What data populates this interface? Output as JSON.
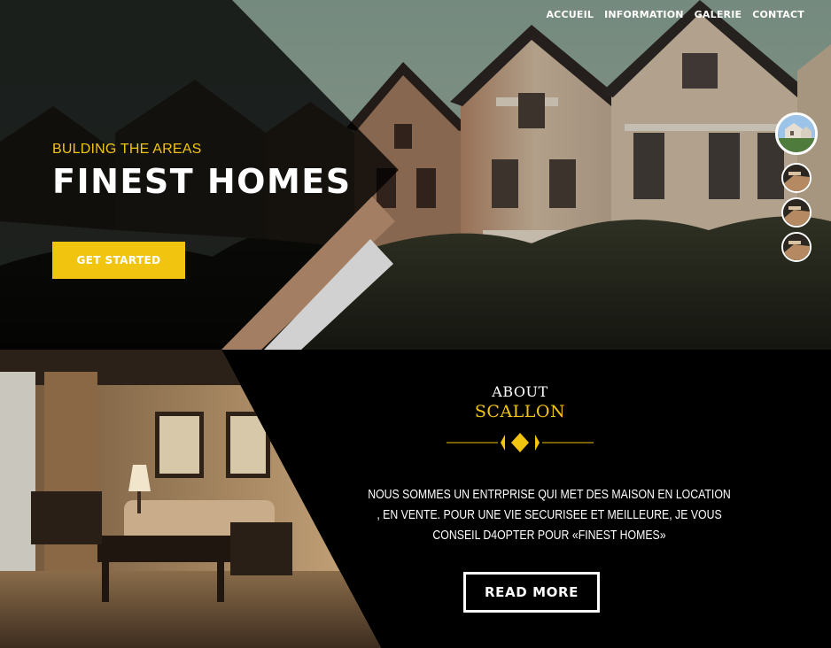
{
  "nav": {
    "items": [
      "ACCUEIL",
      "INFORMATION",
      "GALERIE",
      "CONTACT"
    ]
  },
  "hero": {
    "subtitle": "BULDING THE AREAS",
    "title": "FINEST HOMES",
    "cta_label": "GET STARTED"
  },
  "slider": {
    "thumbnails": [
      "house-thumbnail",
      "slide-thumbnail",
      "slide-thumbnail",
      "slide-thumbnail"
    ],
    "active_index": 0
  },
  "about": {
    "label": "ABOUT",
    "name": "SCALLON",
    "text": "NOUS SOMMES UN ENTRPRISE QUI MET DES MAISON EN LOCATION , EN VENTE. POUR UNE VIE SECURISEE ET MEILLEURE, JE VOUS CONSEIL D4OPTER POUR «FINEST HOMES»",
    "button_label": "READ MORE"
  },
  "colors": {
    "accent": "#f1c40f",
    "dark": "#000000",
    "tan": "#c79a78",
    "white": "#ffffff"
  }
}
